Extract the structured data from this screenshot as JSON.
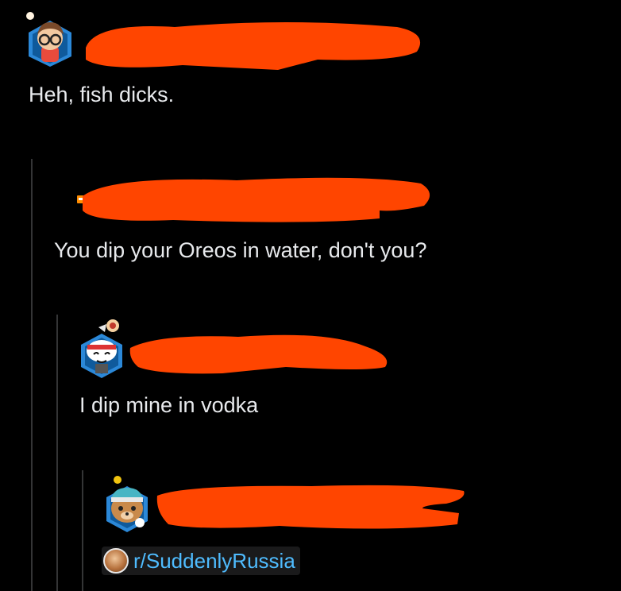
{
  "comments": [
    {
      "author": "",
      "text": "Heh, fish dicks."
    },
    {
      "author": "",
      "text": "You dip your Oreos in water, don't you?"
    },
    {
      "author": "",
      "text": "I dip mine in vodka"
    },
    {
      "author": "",
      "subreddit_link": "r/SuddenlyRussia"
    }
  ],
  "colors": {
    "redaction": "#ff4500",
    "link": "#4fbcff",
    "background": "#000000"
  }
}
